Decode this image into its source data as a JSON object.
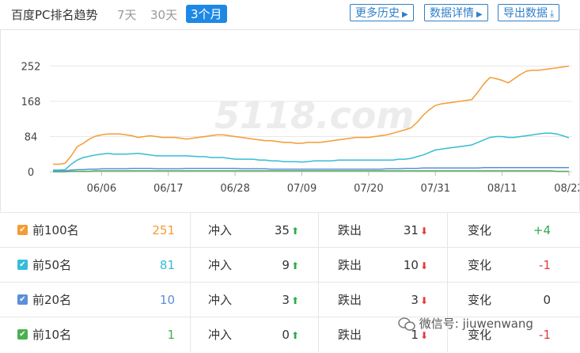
{
  "header": {
    "title": "百度PC排名趋势",
    "ranges": [
      "7天",
      "30天",
      "3个月"
    ],
    "active_range": "3个月",
    "buttons": {
      "history": "更多历史",
      "details": "数据详情",
      "export": "导出数据"
    }
  },
  "chart_data": {
    "type": "line",
    "y_ticks": [
      "252",
      "168",
      "84",
      "0"
    ],
    "ylim": [
      0,
      270
    ],
    "x_ticks": [
      "06/06",
      "06/17",
      "06/28",
      "07/09",
      "07/20",
      "07/31",
      "08/11",
      "08/22"
    ],
    "x_tick_index": [
      8,
      19,
      30,
      41,
      52,
      63,
      74,
      85
    ],
    "watermark": "5118.com",
    "colors": {
      "top100": "#f39c33",
      "top50": "#36bcd6",
      "top20": "#5b8fd9",
      "top10": "#4caf50"
    },
    "series": [
      {
        "name": "前100名",
        "color": "#f39c33",
        "values": [
          18,
          18,
          20,
          38,
          60,
          68,
          78,
          85,
          88,
          90,
          90,
          90,
          88,
          86,
          82,
          84,
          86,
          84,
          82,
          82,
          82,
          80,
          78,
          80,
          82,
          84,
          86,
          88,
          88,
          86,
          84,
          82,
          80,
          78,
          76,
          74,
          74,
          72,
          70,
          70,
          68,
          68,
          70,
          70,
          70,
          72,
          74,
          76,
          78,
          80,
          82,
          82,
          82,
          84,
          86,
          88,
          92,
          96,
          100,
          105,
          118,
          135,
          148,
          158,
          162,
          164,
          166,
          168,
          170,
          172,
          190,
          210,
          225,
          222,
          218,
          212,
          222,
          232,
          240,
          242,
          242,
          244,
          246,
          248,
          250,
          252
        ]
      },
      {
        "name": "前50名",
        "color": "#36bcd6",
        "values": [
          4,
          4,
          5,
          18,
          28,
          34,
          37,
          40,
          42,
          44,
          42,
          42,
          42,
          43,
          44,
          42,
          40,
          38,
          38,
          38,
          38,
          38,
          38,
          37,
          36,
          36,
          34,
          34,
          34,
          32,
          30,
          30,
          30,
          30,
          28,
          28,
          26,
          26,
          24,
          24,
          24,
          23,
          24,
          26,
          26,
          26,
          26,
          28,
          28,
          28,
          28,
          28,
          28,
          28,
          28,
          28,
          28,
          30,
          30,
          32,
          36,
          40,
          46,
          52,
          54,
          56,
          58,
          60,
          62,
          64,
          70,
          76,
          82,
          84,
          84,
          82,
          82,
          84,
          86,
          88,
          90,
          92,
          92,
          90,
          86,
          81
        ]
      },
      {
        "name": "前20名",
        "color": "#5b8fd9",
        "values": [
          2,
          2,
          2,
          4,
          5,
          5,
          6,
          6,
          7,
          7,
          7,
          7,
          7,
          8,
          8,
          8,
          8,
          7,
          7,
          7,
          7,
          7,
          8,
          8,
          8,
          8,
          8,
          8,
          8,
          8,
          8,
          7,
          7,
          7,
          7,
          7,
          6,
          6,
          6,
          6,
          6,
          6,
          6,
          6,
          6,
          6,
          6,
          6,
          6,
          6,
          6,
          6,
          6,
          6,
          6,
          7,
          7,
          7,
          8,
          8,
          8,
          9,
          9,
          9,
          9,
          9,
          9,
          9,
          9,
          9,
          9,
          10,
          10,
          10,
          10,
          10,
          10,
          10,
          10,
          10,
          10,
          10,
          10,
          10,
          10,
          10
        ]
      },
      {
        "name": "前10名",
        "color": "#4caf50",
        "values": [
          0,
          0,
          0,
          1,
          1,
          1,
          1,
          2,
          2,
          2,
          2,
          2,
          2,
          2,
          2,
          2,
          2,
          2,
          2,
          2,
          2,
          2,
          2,
          2,
          2,
          2,
          2,
          2,
          2,
          2,
          2,
          2,
          2,
          2,
          2,
          2,
          2,
          2,
          2,
          2,
          2,
          2,
          2,
          2,
          2,
          2,
          2,
          2,
          2,
          2,
          2,
          2,
          2,
          2,
          2,
          2,
          2,
          2,
          2,
          2,
          2,
          2,
          2,
          2,
          2,
          2,
          2,
          2,
          2,
          2,
          2,
          2,
          2,
          2,
          2,
          2,
          2,
          2,
          2,
          2,
          2,
          2,
          2,
          1,
          1,
          1
        ]
      }
    ]
  },
  "stats": [
    {
      "label": "前100名",
      "count": "251",
      "color": "#f39c33",
      "in_label": "冲入",
      "in_val": "35",
      "out_label": "跌出",
      "out_val": "31",
      "chg_label": "变化",
      "chg_val": "+4",
      "chg_color": "#2eab4e"
    },
    {
      "label": "前50名",
      "count": "81",
      "color": "#36bcd6",
      "in_label": "冲入",
      "in_val": "9",
      "out_label": "跌出",
      "out_val": "10",
      "chg_label": "变化",
      "chg_val": "-1",
      "chg_color": "#e53935"
    },
    {
      "label": "前20名",
      "count": "10",
      "color": "#5b8fd9",
      "in_label": "冲入",
      "in_val": "3",
      "out_label": "跌出",
      "out_val": "3",
      "chg_label": "变化",
      "chg_val": "0",
      "chg_color": "#333333"
    },
    {
      "label": "前10名",
      "count": "1",
      "color": "#4caf50",
      "in_label": "冲入",
      "in_val": "0",
      "out_label": "跌出",
      "out_val": "1",
      "chg_label": "变化",
      "chg_val": "-1",
      "chg_color": "#e53935"
    }
  ],
  "watermark_text": "微信号: jiuwenwang",
  "icons": {
    "arrow_up": "arrow-up-icon",
    "arrow_down": "arrow-down-icon",
    "checkbox": "checkbox-icon",
    "caret": "caret-right-icon",
    "download": "download-icon"
  }
}
